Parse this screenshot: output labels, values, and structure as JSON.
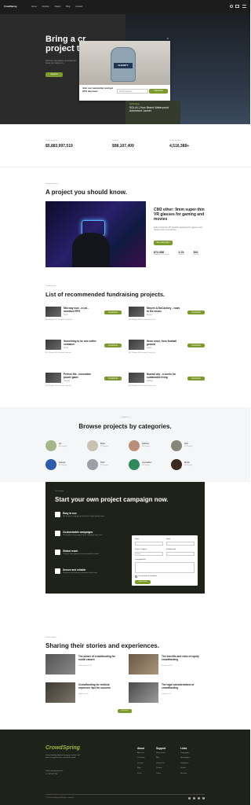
{
  "nav": {
    "logo": "CrowdSpring",
    "links": [
      "Home",
      "Explore",
      "Pages",
      "Blog",
      "Contact"
    ]
  },
  "hero": {
    "title_l1": "Bring a cr",
    "title_l2": "project to",
    "subtitle": "Discover campaigns and back the ideas you believe in.",
    "cta": "Explore"
  },
  "popup": {
    "text": "Join our newsletter and get 20% discount",
    "email_placeholder": "Email address",
    "submit": "Subscribe",
    "jar_label": "CHARITY"
  },
  "promo": {
    "tag": "Technology",
    "title": "SOLAI | Your Brand Waterproof Adventure Jacket"
  },
  "stats": [
    {
      "label": "Funded projects",
      "value": "$5,883,997,519"
    },
    {
      "label": "Funded",
      "value": "$98,107,409"
    },
    {
      "label": "Project backers",
      "value": "4,516,388+"
    }
  ],
  "featured": {
    "kicker": "Featured project",
    "heading": "A project you should know.",
    "title": "CM3 ether: 9mm super-thin VR glasses for gaming and movies",
    "desc": "Fully immersive VR headset designed for gamers and movie lovers everywhere.",
    "button": "See Campaign",
    "stats": [
      {
        "value": "$72,358",
        "label": "Pledged of $75,000 goal"
      },
      {
        "value": "2.7k",
        "label": "Backers"
      },
      {
        "value": "302",
        "label": "Days left"
      }
    ]
  },
  "recommended": {
    "kicker": "Trending now",
    "heading": "List of recommended fundraising projects.",
    "button": "Contribute",
    "items": [
      {
        "title": "Mid way now - a cat - narrative RPG",
        "meta": "Tech",
        "foot": "$44 Pledged  27% Funded  12 days left"
      },
      {
        "title": "Meyers & McCartney - vows to the music",
        "meta": "Music",
        "foot": "$83 Pledged  39% Funded  18 days left"
      },
      {
        "title": "Something to be one coffee container",
        "meta": "Food",
        "foot": "$51 Pledged  58% Funded  9 days left"
      },
      {
        "title": "Neon court, from football ground",
        "meta": "Sport",
        "foot": "$62 Pledged  44% Funded  21 days left"
      },
      {
        "title": "Perfect fits - innovative puzzle game",
        "meta": "Games",
        "foot": "$38 Pledged  71% Funded  7 days left"
      },
      {
        "title": "Nomad city - a series for sustainable living",
        "meta": "Design",
        "foot": "$90 Pledged  33% Funded  15 days left"
      }
    ]
  },
  "categories": {
    "kicker": "Categories",
    "heading": "Browse projects by categories.",
    "items": [
      {
        "name": "Art",
        "count": "48 Projects"
      },
      {
        "name": "Book",
        "count": "12 Projects"
      },
      {
        "name": "Fashion",
        "count": "36 Projects"
      },
      {
        "name": "Film",
        "count": "27 Projects"
      },
      {
        "name": "Games",
        "count": "41 Projects"
      },
      {
        "name": "Tech",
        "count": "55 Projects"
      },
      {
        "name": "Journalism",
        "count": "19 Projects"
      },
      {
        "name": "Music",
        "count": "33 Projects"
      }
    ]
  },
  "start": {
    "kicker": "Get started",
    "heading": "Start your own project campaign now.",
    "features": [
      {
        "title": "Easy to use",
        "desc": "Set up your campaign quickly with simple guided steps."
      },
      {
        "title": "Customizable campaigns",
        "desc": "Personalize every page of your campaign with ease."
      },
      {
        "title": "Global reach",
        "desc": "Connect with supporters from around the world."
      },
      {
        "title": "Secure and reliable",
        "desc": "Payments and data are protected end to end."
      }
    ],
    "form": {
      "name": "Name",
      "email": "Email",
      "category": "Project Category",
      "select": "Select",
      "goal": "Funding Goal",
      "description": "Campaign Brief",
      "agree": "I accept terms & conditions",
      "submit": "Submit Now"
    }
  },
  "stories": {
    "kicker": "Latest updates",
    "heading": "Sharing their stories and experiences.",
    "more": "View More",
    "items": [
      {
        "title": "The power of crowdfunding for social causes",
        "meta": "Community  Jan 12"
      },
      {
        "title": "The benefits and risks of equity crowdfunding",
        "meta": "Finance  Jan 08"
      },
      {
        "title": "Crowdfunding for medical expenses: tips for success",
        "meta": "Health  Dec 29"
      },
      {
        "title": "The legal considerations of crowdfunding",
        "meta": "Legal  Dec 21"
      }
    ]
  },
  "footer": {
    "logo": "CrowdSpring",
    "desc": "Crowd funding platform bringing creators and backers together from around the world.",
    "contact": "info@crowdspring.com",
    "phone": "+1 234 567 890",
    "cols": [
      {
        "title": "About",
        "links": [
          "About Us",
          "Our Team",
          "Careers",
          "Blog",
          "Press"
        ]
      },
      {
        "title": "Support",
        "links": [
          "Help Center",
          "FAQ",
          "Contact Us",
          "Privacy",
          "Terms"
        ]
      },
      {
        "title": "Links",
        "links": [
          "Campaigns",
          "Start project",
          "Categories",
          "Stories",
          "Account"
        ]
      }
    ],
    "copyright": "© 2024 CrowdSpring. All rights reserved."
  },
  "colors": {
    "accent": "#7d9a2c",
    "dark": "#1f2219"
  }
}
